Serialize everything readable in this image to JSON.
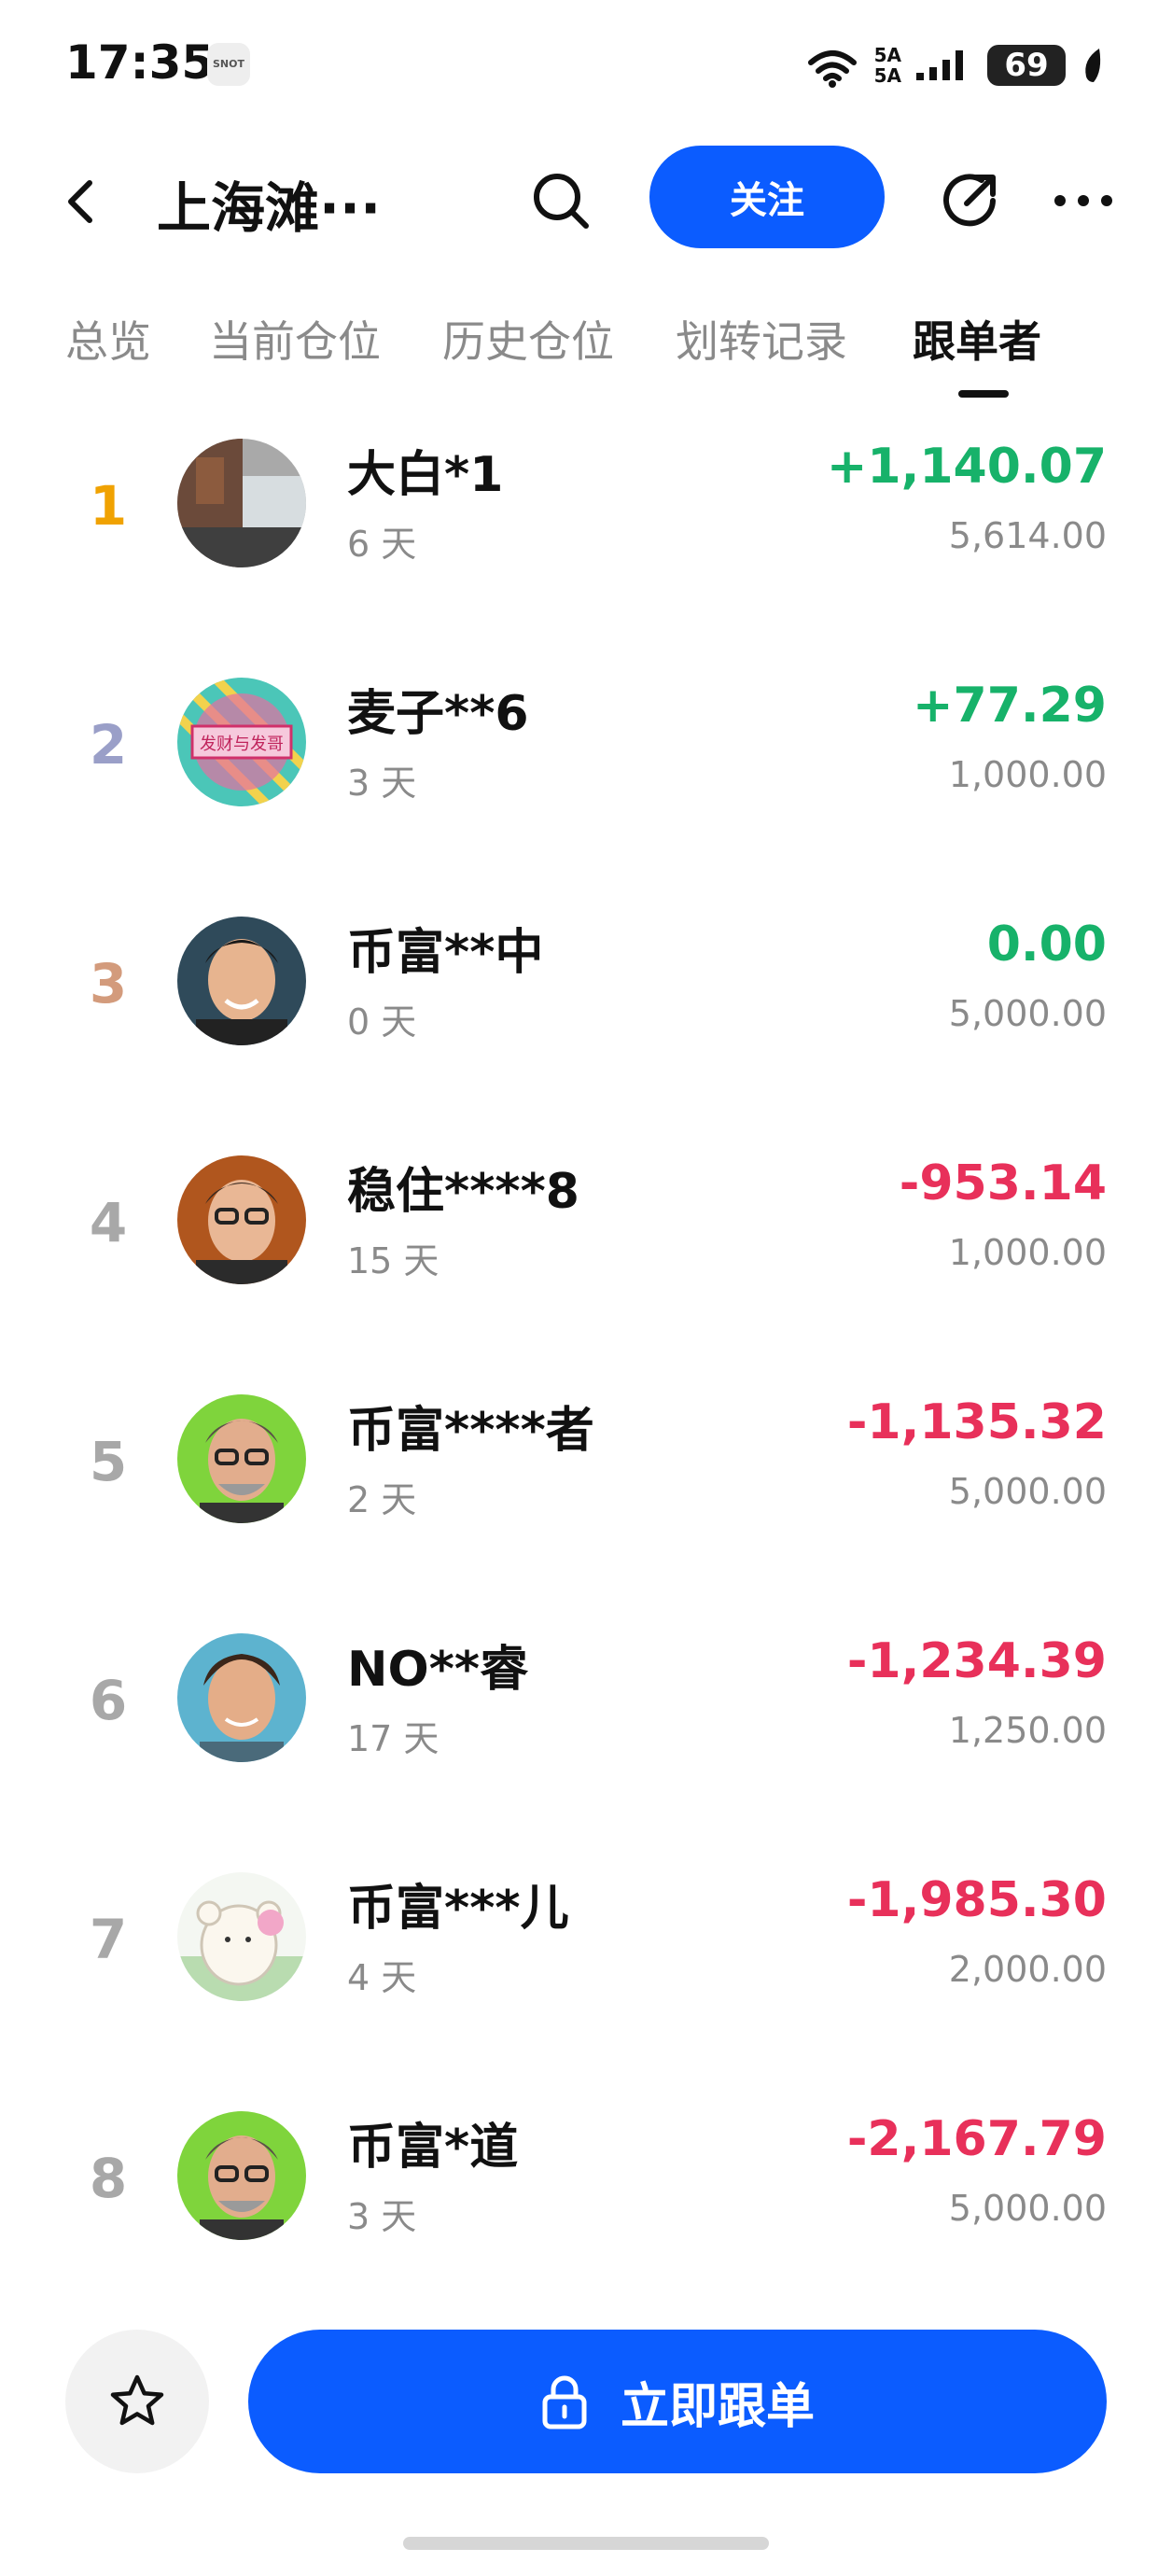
{
  "status_bar": {
    "time": "17:35",
    "app_badge": "SNOT",
    "network_top": "5A",
    "network_bottom": "5A",
    "wifi_label": "6",
    "battery": "69"
  },
  "header": {
    "title": "上海滩···",
    "follow_label": "关注"
  },
  "tabs": [
    {
      "label": "总览"
    },
    {
      "label": "当前仓位"
    },
    {
      "label": "历史仓位"
    },
    {
      "label": "划转记录"
    },
    {
      "label": "跟单者",
      "active": true
    }
  ],
  "followers": [
    {
      "rank": "1",
      "name": "大白*1",
      "days": "6 天",
      "pnl": "+1,140.07",
      "amount": "5,614.00",
      "rank_color": "#f0a202",
      "pnl_color": "#17b26a"
    },
    {
      "rank": "2",
      "name": "麦子**6",
      "days": "3 天",
      "pnl": "+77.29",
      "amount": "1,000.00",
      "rank_color": "#9a9fc8",
      "pnl_color": "#17b26a"
    },
    {
      "rank": "3",
      "name": "币富**中",
      "days": "0 天",
      "pnl": "0.00",
      "amount": "5,000.00",
      "rank_color": "#d39b7c",
      "pnl_color": "#17b26a"
    },
    {
      "rank": "4",
      "name": "稳住****8",
      "days": "15 天",
      "pnl": "-953.14",
      "amount": "1,000.00",
      "rank_color": "#a8a8a8",
      "pnl_color": "#e8305a"
    },
    {
      "rank": "5",
      "name": "币富****者",
      "days": "2 天",
      "pnl": "-1,135.32",
      "amount": "5,000.00",
      "rank_color": "#a8a8a8",
      "pnl_color": "#e8305a"
    },
    {
      "rank": "6",
      "name": "NO**睿",
      "days": "17 天",
      "pnl": "-1,234.39",
      "amount": "1,250.00",
      "rank_color": "#a8a8a8",
      "pnl_color": "#e8305a"
    },
    {
      "rank": "7",
      "name": "币富***儿",
      "days": "4 天",
      "pnl": "-1,985.30",
      "amount": "2,000.00",
      "rank_color": "#a8a8a8",
      "pnl_color": "#e8305a"
    },
    {
      "rank": "8",
      "name": "币富*道",
      "days": "3 天",
      "pnl": "-2,167.79",
      "amount": "5,000.00",
      "rank_color": "#a8a8a8",
      "pnl_color": "#e8305a"
    }
  ],
  "footer": {
    "copy_label": "立即跟单",
    "avatar_2_text": "发财与发哥"
  },
  "colors": {
    "accent": "#0b5cff",
    "positive": "#17b26a",
    "negative": "#e8305a"
  }
}
